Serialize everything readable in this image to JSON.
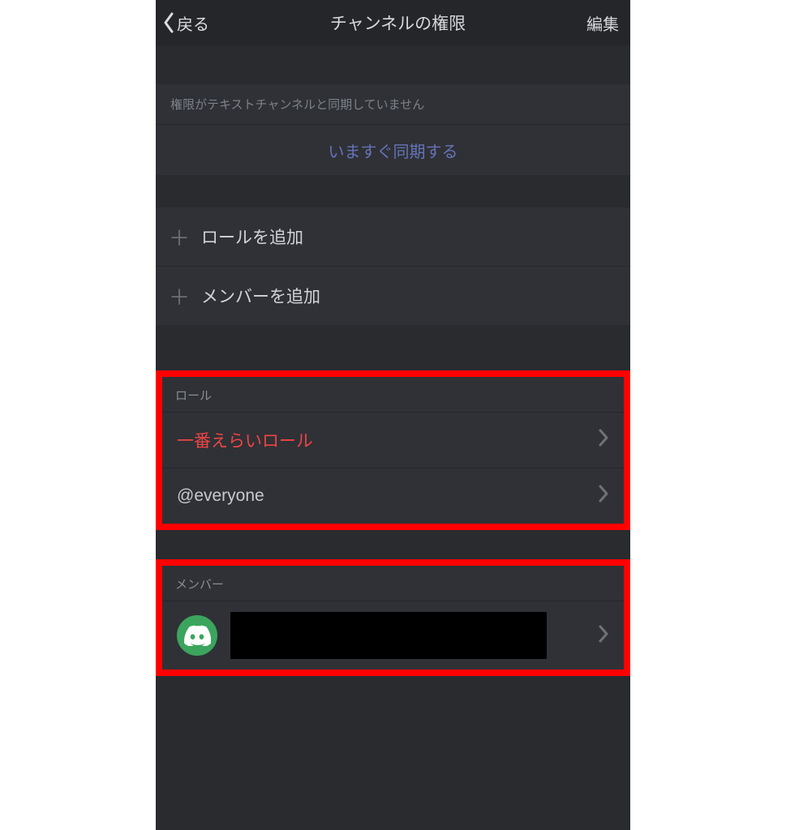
{
  "header": {
    "back": "戻る",
    "title": "チャンネルの権限",
    "edit": "編集"
  },
  "notice": "権限がテキストチャンネルと同期していません",
  "sync": "いますぐ同期する",
  "add": {
    "role": "ロールを追加",
    "member": "メンバーを追加"
  },
  "roles": {
    "header": "ロール",
    "items": [
      {
        "name": "一番えらいロール",
        "color": "red"
      },
      {
        "name": "@everyone",
        "color": "normal"
      }
    ]
  },
  "members": {
    "header": "メンバー"
  }
}
